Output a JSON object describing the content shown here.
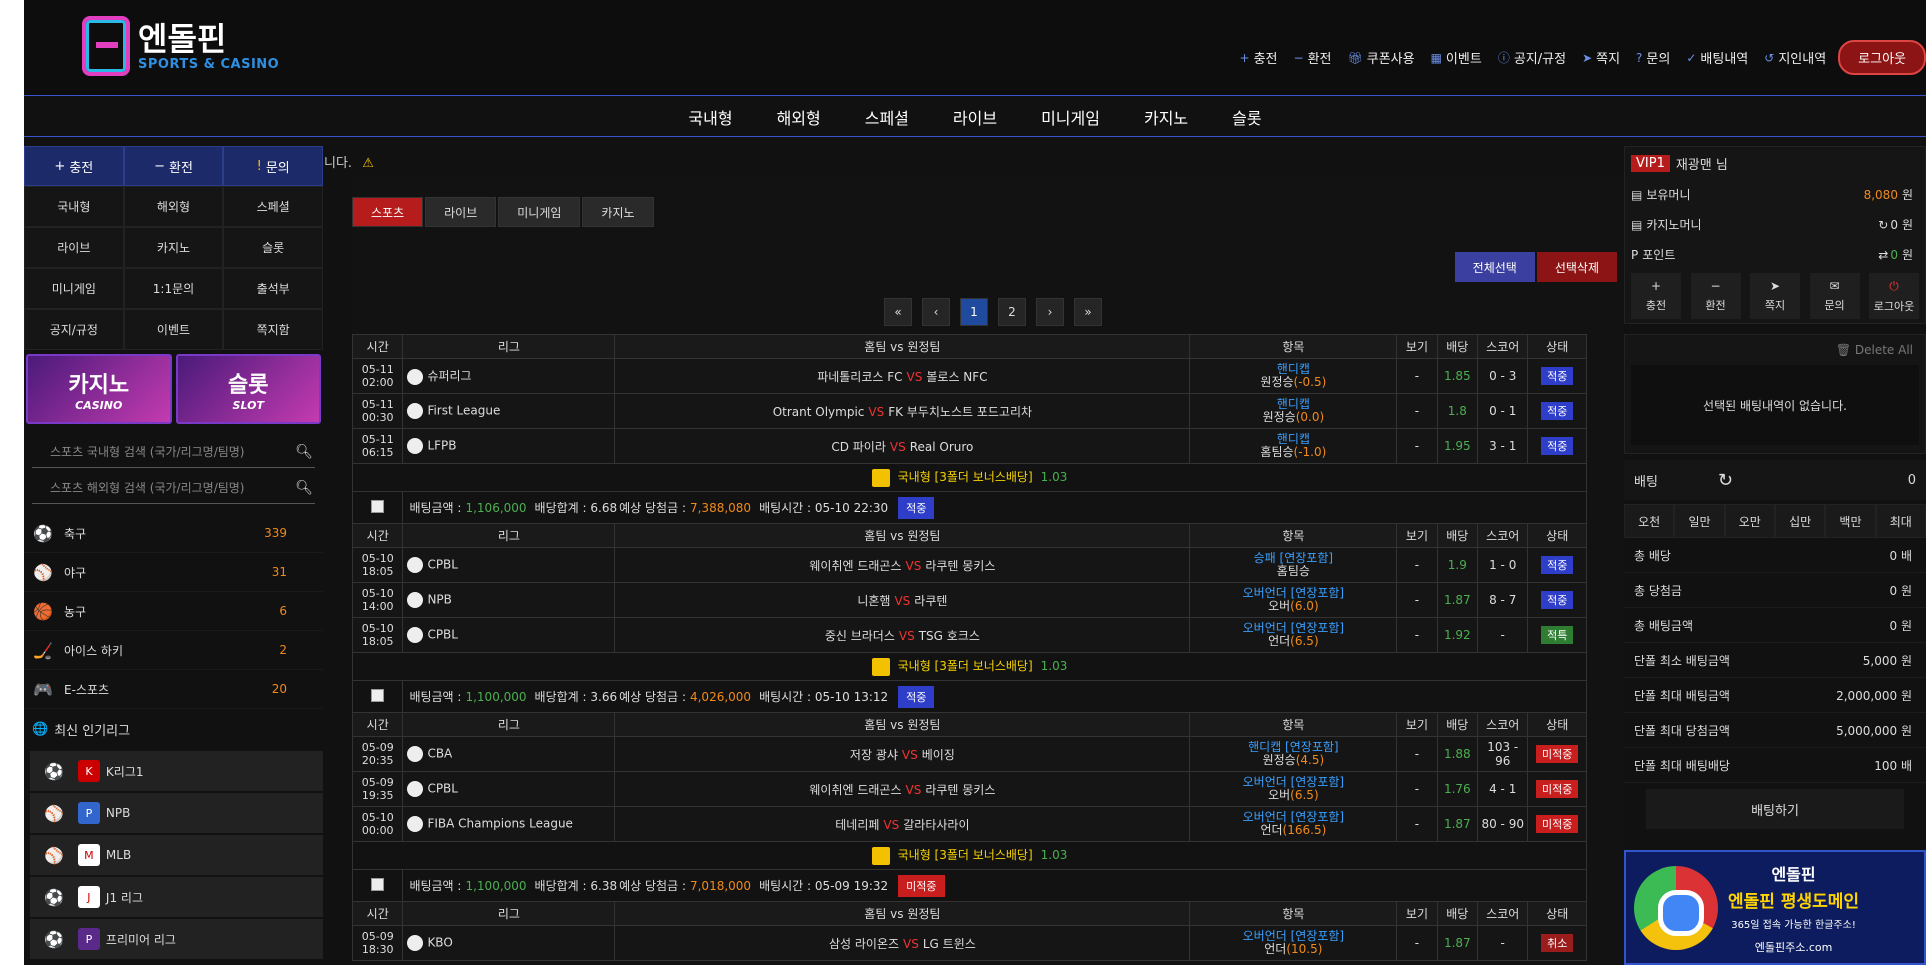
{
  "brand": {
    "name_ko": "엔돌핀",
    "name_en": "SPORTS & CASINO"
  },
  "topnav": [
    {
      "icon": "plus",
      "label": "충전"
    },
    {
      "icon": "minus",
      "label": "환전"
    },
    {
      "icon": "gift",
      "label": "쿠폰사용"
    },
    {
      "icon": "calendar",
      "label": "이벤트"
    },
    {
      "icon": "info",
      "label": "공지/규정"
    },
    {
      "icon": "send",
      "label": "쪽지"
    },
    {
      "icon": "question",
      "label": "문의"
    },
    {
      "icon": "check",
      "label": "배팅내역"
    },
    {
      "icon": "history",
      "label": "지인내역"
    }
  ],
  "logout_label": "로그아웃",
  "mainnav": [
    "국내형",
    "해외형",
    "스페셜",
    "라이브",
    "미니게임",
    "카지노",
    "슬롯"
  ],
  "ticker": "니다.",
  "left": {
    "quick": [
      {
        "icon": "+",
        "label": "충전"
      },
      {
        "icon": "−",
        "label": "환전"
      },
      {
        "icon": "!",
        "label": "문의"
      }
    ],
    "grid": [
      "국내형",
      "해외형",
      "스페셜",
      "라이브",
      "카지노",
      "슬롯",
      "미니게임",
      "1:1문의",
      "출석부",
      "공지/규정",
      "이벤트",
      "쪽지함"
    ],
    "banners": [
      {
        "title": "카지노",
        "sub": "CASINO"
      },
      {
        "title": "슬롯",
        "sub": "SLOT"
      }
    ],
    "search_domestic": "스포츠 국내형 검색 (국가/리그명/팀명)",
    "search_foreign": "스포츠 해외형 검색 (국가/리그명/팀명)",
    "sports": [
      {
        "name": "축구",
        "count": "339",
        "icon": "⚽"
      },
      {
        "name": "야구",
        "count": "31",
        "icon": "⚾"
      },
      {
        "name": "농구",
        "count": "6",
        "icon": "🏀"
      },
      {
        "name": "아이스 하키",
        "count": "2",
        "icon": "🏒"
      },
      {
        "name": "E-스포츠",
        "count": "20",
        "icon": "🎮"
      }
    ],
    "popular_title": "최신 인기리그",
    "leagues": [
      {
        "name": "K리그1",
        "ball": "⚽",
        "logo": "K"
      },
      {
        "name": "NPB",
        "ball": "⚾",
        "logo": "P"
      },
      {
        "name": "MLB",
        "ball": "⚾",
        "logo": "M"
      },
      {
        "name": "J1 리그",
        "ball": "⚽",
        "logo": "J"
      },
      {
        "name": "프리미어 리그",
        "ball": "⚽",
        "logo": "P"
      }
    ]
  },
  "center": {
    "tabs": [
      "스포츠",
      "라이브",
      "미니게임",
      "카지노"
    ],
    "select_all": "전체선택",
    "delete_selected": "선택삭제",
    "pager": [
      "«",
      "‹",
      "1",
      "2",
      "›",
      "»"
    ],
    "headers": [
      "시간",
      "리그",
      "홈팀 vs 원정팀",
      "항목",
      "보기",
      "배당",
      "스코어",
      "상태"
    ],
    "vs": "VS",
    "groups": [
      {
        "rows": [
          {
            "date": "05-11",
            "time": "02:00",
            "league": "슈퍼리그",
            "home": "파네톨리코스 FC",
            "away": "볼로스 NFC",
            "market": "핸디캡",
            "pick": "원정승",
            "line": "(-0.5)",
            "view": "-",
            "odds": "1.85",
            "score": "0 - 3",
            "status": "적중",
            "st": "hit"
          },
          {
            "date": "05-11",
            "time": "00:30",
            "league": "First League",
            "home": "Otrant Olympic",
            "away": "FK 부두치노스트 포드고리차",
            "market": "핸디캡",
            "pick": "원정승",
            "line": "(0.0)",
            "view": "-",
            "odds": "1.8",
            "score": "0 - 1",
            "status": "적중",
            "st": "hit"
          },
          {
            "date": "05-11",
            "time": "06:15",
            "league": "LFPB",
            "home": "CD 파이라",
            "away": "Real Oruro",
            "market": "핸디캡",
            "pick": "홈팀승",
            "line": "(-1.0)",
            "view": "-",
            "odds": "1.95",
            "score": "3 - 1",
            "status": "적중",
            "st": "hit"
          }
        ],
        "bonus": {
          "title": "국내형 [3폴더 보너스배당]",
          "value": "1.03"
        },
        "summary": {
          "amount_label": "배팅금액 :",
          "amount": "1,106,000",
          "total_label": "배당합계 : 6.68",
          "expected_label": "예상 당첨금 :",
          "expected": "7,388,080",
          "time_label": "배팅시간 : 05-10 22:30",
          "status": "적중",
          "st": "hit"
        }
      },
      {
        "rows": [
          {
            "date": "05-10",
            "time": "18:05",
            "league": "CPBL",
            "home": "웨이취엔 드래곤스",
            "away": "라쿠텐 몽키스",
            "market": "승패 [연장포함]",
            "pick": "홈팀승",
            "line": "",
            "view": "-",
            "odds": "1.9",
            "score": "1 - 0",
            "status": "적중",
            "st": "hit"
          },
          {
            "date": "05-10",
            "time": "14:00",
            "league": "NPB",
            "home": "니혼햄",
            "away": "라쿠텐",
            "market": "오버언더 [연장포함]",
            "pick": "오버",
            "line": "(6.0)",
            "view": "-",
            "odds": "1.87",
            "score": "8 - 7",
            "status": "적중",
            "st": "hit"
          },
          {
            "date": "05-10",
            "time": "18:05",
            "league": "CPBL",
            "home": "중신 브라더스",
            "away": "TSG 호크스",
            "market": "오버언더 [연장포함]",
            "pick": "언더",
            "line": "(6.5)",
            "view": "-",
            "odds": "1.92",
            "score": "-",
            "status": "적특",
            "st": "win"
          }
        ],
        "bonus": {
          "title": "국내형 [3폴더 보너스배당]",
          "value": "1.03"
        },
        "summary": {
          "amount_label": "배팅금액 :",
          "amount": "1,100,000",
          "total_label": "배당합계 : 3.66",
          "expected_label": "예상 당첨금 :",
          "expected": "4,026,000",
          "time_label": "배팅시간 : 05-10 13:12",
          "status": "적중",
          "st": "hit"
        }
      },
      {
        "rows": [
          {
            "date": "05-09",
            "time": "20:35",
            "league": "CBA",
            "home": "저장 광샤",
            "away": "베이징",
            "market": "핸디캡 [연장포함]",
            "pick": "원정승",
            "line": "(4.5)",
            "view": "-",
            "odds": "1.88",
            "score": "103 - 96",
            "status": "미적중",
            "st": "fail"
          },
          {
            "date": "05-09",
            "time": "19:35",
            "league": "CPBL",
            "home": "웨이취엔 드래곤스",
            "away": "라쿠텐 몽키스",
            "market": "오버언더 [연장포함]",
            "pick": "오버",
            "line": "(6.5)",
            "view": "-",
            "odds": "1.76",
            "score": "4 - 1",
            "status": "미적중",
            "st": "fail"
          },
          {
            "date": "05-10",
            "time": "00:00",
            "league": "FIBA Champions League",
            "home": "테네리페",
            "away": "갈라타사라이",
            "market": "오버언더 [연장포함]",
            "pick": "언더",
            "line": "(166.5)",
            "view": "-",
            "odds": "1.87",
            "score": "80 - 90",
            "status": "미적중",
            "st": "fail"
          }
        ],
        "bonus": {
          "title": "국내형 [3폴더 보너스배당]",
          "value": "1.03"
        },
        "summary": {
          "amount_label": "배팅금액 :",
          "amount": "1,100,000",
          "total_label": "배당합계 : 6.38",
          "expected_label": "예상 당첨금 :",
          "expected": "7,018,000",
          "time_label": "배팅시간 : 05-09 19:32",
          "status": "미적중",
          "st": "fail"
        }
      },
      {
        "rows": [
          {
            "date": "05-09",
            "time": "18:30",
            "league": "KBO",
            "home": "삼성 라이온즈",
            "away": "LG 트윈스",
            "market": "오버언더 [연장포함]",
            "pick": "언더",
            "line": "(10.5)",
            "view": "-",
            "odds": "1.87",
            "score": "-",
            "status": "취소",
            "st": "can"
          }
        ]
      }
    ]
  },
  "right": {
    "vip": "VIP1",
    "user": "재광맨 님",
    "money": [
      {
        "label": "보유머니",
        "value": "8,080",
        "unit": "원",
        "icon": "▤",
        "pre": ""
      },
      {
        "label": "카지노머니",
        "value": "0",
        "unit": "원",
        "icon": "▤",
        "pre": "↻"
      },
      {
        "label": "포인트",
        "value": "0",
        "unit": "원",
        "icon": "P",
        "pre": "⇄"
      }
    ],
    "btns": [
      {
        "icon": "+",
        "label": "충전"
      },
      {
        "icon": "−",
        "label": "환전"
      },
      {
        "icon": "➤",
        "label": "쪽지"
      },
      {
        "icon": "✉",
        "label": "문의"
      },
      {
        "icon": "⏻",
        "label": "로그아웃"
      }
    ],
    "delete_all": "Delete All",
    "no_bet": "선택된 배팅내역이 없습니다.",
    "bet_label": "배팅",
    "bet_value": "0",
    "amounts": [
      "오천",
      "일만",
      "오만",
      "십만",
      "백만",
      "최대"
    ],
    "totals": [
      {
        "label": "총 배당",
        "value": "0 배"
      },
      {
        "label": "총 당첨금",
        "value": "0 원"
      },
      {
        "label": "총 배팅금액",
        "value": "0 원"
      },
      {
        "label": "단폴 최소 배팅금액",
        "value": "5,000 원"
      },
      {
        "label": "단폴 최대 배팅금액",
        "value": "2,000,000 원"
      },
      {
        "label": "단폴 최대 당첨금액",
        "value": "5,000,000 원"
      },
      {
        "label": "단폴 최대 배팅배당",
        "value": "100 배"
      }
    ],
    "bet_button": "배팅하기",
    "ad": {
      "brand": "엔돌핀",
      "title": "엔돌핀 평생도메인",
      "sub": "365일 접속 가능한 한글주소!",
      "url": "엔돌핀주소.com"
    }
  },
  "colors": {
    "accent_blue": "#2e3ec9",
    "accent_red": "#b71c1c",
    "orange": "#f08a1c",
    "green": "#4caf50"
  }
}
